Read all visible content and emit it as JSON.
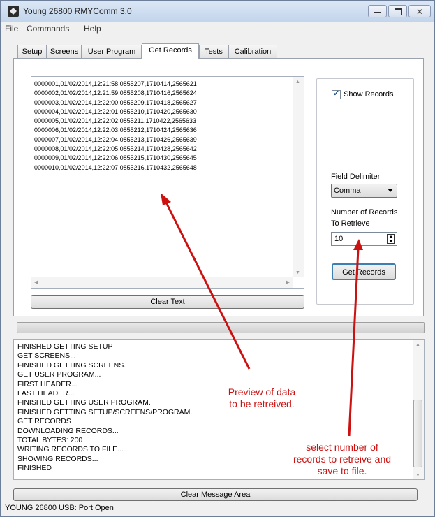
{
  "window": {
    "title": "Young 26800 RMYComm 3.0"
  },
  "menu": [
    "File",
    "Commands",
    "Help"
  ],
  "tabs": [
    {
      "label": "Setup",
      "active": false
    },
    {
      "label": "Screens",
      "active": false
    },
    {
      "label": "User Program",
      "active": false
    },
    {
      "label": "Get Records",
      "active": true
    },
    {
      "label": "Tests",
      "active": false
    },
    {
      "label": "Calibration",
      "active": false
    }
  ],
  "records": [
    "0000001,01/02/2014,12:21:58,0855207,1710414,2565621",
    "0000002,01/02/2014,12:21:59,0855208,1710416,2565624",
    "0000003,01/02/2014,12:22:00,0855209,1710418,2565627",
    "0000004,01/02/2014,12:22:01,0855210,1710420,2565630",
    "0000005,01/02/2014,12:22:02,0855211,1710422,2565633",
    "0000006,01/02/2014,12:22:03,0855212,1710424,2565636",
    "0000007,01/02/2014,12:22:04,0855213,1710426,2565639",
    "0000008,01/02/2014,12:22:05,0855214,1710428,2565642",
    "0000009,01/02/2014,12:22:06,0855215,1710430,2565645",
    "0000010,01/02/2014,12:22:07,0855216,1710432,2565648"
  ],
  "clear_text_label": "Clear Text",
  "options": {
    "show_records_label": "Show Records",
    "show_records_checked": true,
    "field_delimiter_label": "Field Delimiter",
    "field_delimiter_value": "Comma",
    "num_records_label_1": "Number of Records",
    "num_records_label_2": "To Retrieve",
    "num_records_value": "10",
    "get_records_label": "Get Records"
  },
  "messages": [
    "FINISHED GETTING SETUP",
    "GET SCREENS...",
    "FINISHED GETTING SCREENS.",
    "GET USER PROGRAM...",
    "FIRST HEADER...",
    "LAST HEADER...",
    "FINISHED GETTING USER PROGRAM.",
    "FINISHED GETTING SETUP/SCREENS/PROGRAM.",
    "GET RECORDS",
    "DOWNLOADING RECORDS...",
    "TOTAL BYTES: 200",
    "WRITING RECORDS TO FILE...",
    "SHOWING RECORDS...",
    "FINISHED"
  ],
  "clear_message_label": "Clear Message Area",
  "status": "YOUNG 26800 USB: Port Open",
  "annotations": {
    "preview": [
      "Preview of data",
      "to be retreived."
    ],
    "select": [
      "select number of",
      "records to retreive and",
      "save to file."
    ]
  },
  "colors": {
    "annotation": "#cc1111",
    "focus_button": "#3c7fb1"
  },
  "icons": {
    "window_minimize": "minimize-icon",
    "window_maximize": "maximize-icon",
    "window_close": "close-icon",
    "app": "app-icon"
  }
}
